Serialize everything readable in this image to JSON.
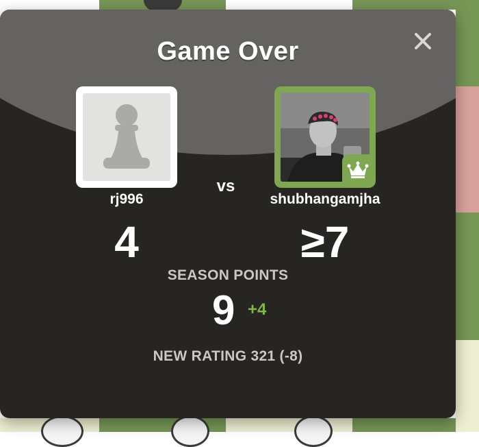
{
  "modal": {
    "title": "Game Over",
    "close_icon": "close-icon"
  },
  "players": {
    "left": {
      "name": "rj996",
      "avatar": "pawn-icon",
      "score": "4"
    },
    "right": {
      "name": "shubhangamjha",
      "avatar": "user-photo",
      "badge": "crown-icon",
      "score": "≥7"
    }
  },
  "vs_label": "vs",
  "season": {
    "label": "SEASON POINTS",
    "points": "9",
    "delta": "+4"
  },
  "rating": {
    "text": "NEW RATING 321 (-8)"
  },
  "colors": {
    "accent_green": "#81b64c",
    "avatar_border_green": "#7fa650",
    "modal_bg": "#262522",
    "header_bg": "#646361",
    "board_green": "#769656",
    "board_light": "#eeeed2",
    "board_highlight": "#d9a19c"
  }
}
